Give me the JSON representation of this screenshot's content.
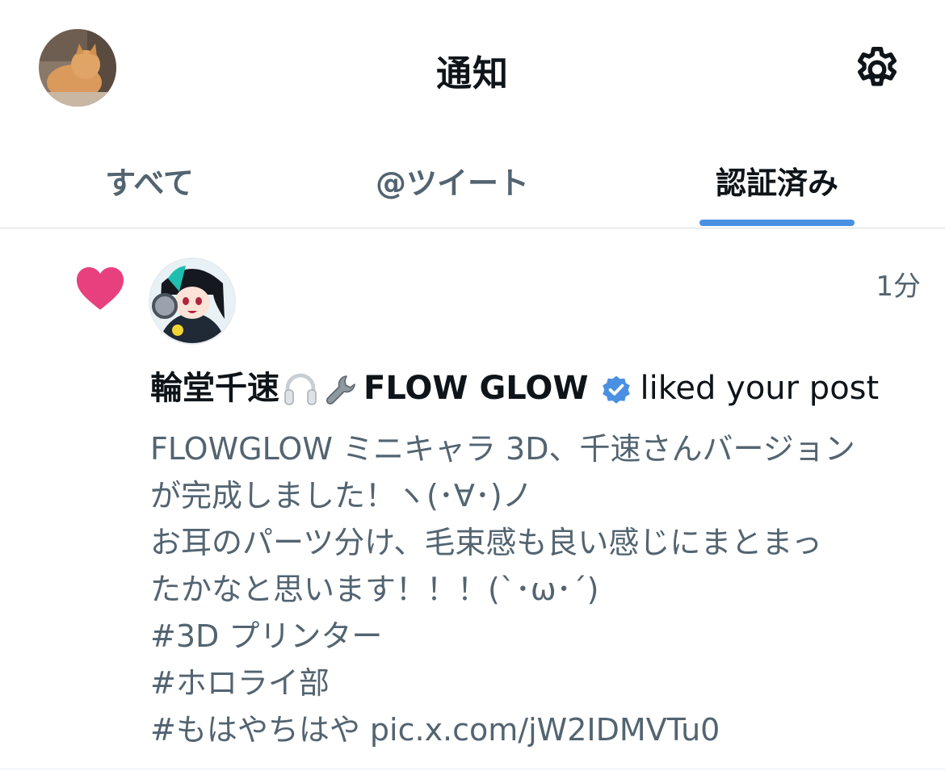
{
  "header": {
    "title": "通知"
  },
  "tabs": [
    {
      "label": "すべて"
    },
    {
      "label": "@ツイート"
    },
    {
      "label": "認証済み"
    }
  ],
  "active_tab": "認証済み",
  "notification": {
    "time": "1分",
    "user_name": "輪堂千速",
    "user_name_suffix": "FLOW GLOW",
    "action": "liked your post",
    "post_lines": [
      "FLOWGLOW ミニキャラ 3D、千速さんバージョン",
      "が完成しました！ヽ(･∀･)ノ",
      "お耳のパーツ分け、毛束感も良い感じにまとまっ",
      "たかなと思います！！！(`･ω･´)",
      "#3D プリンター",
      "#ホロライ部",
      "#もはやちはや pic.x.com/jW2IDMVTu0"
    ]
  },
  "colors": {
    "accent": "#4a90e2",
    "like": "#e8407f",
    "secondary_text": "#536471"
  },
  "icons": [
    "settings-gear-icon",
    "heart-icon",
    "headphones-icon",
    "wrench-icon",
    "verified-badge-icon"
  ]
}
